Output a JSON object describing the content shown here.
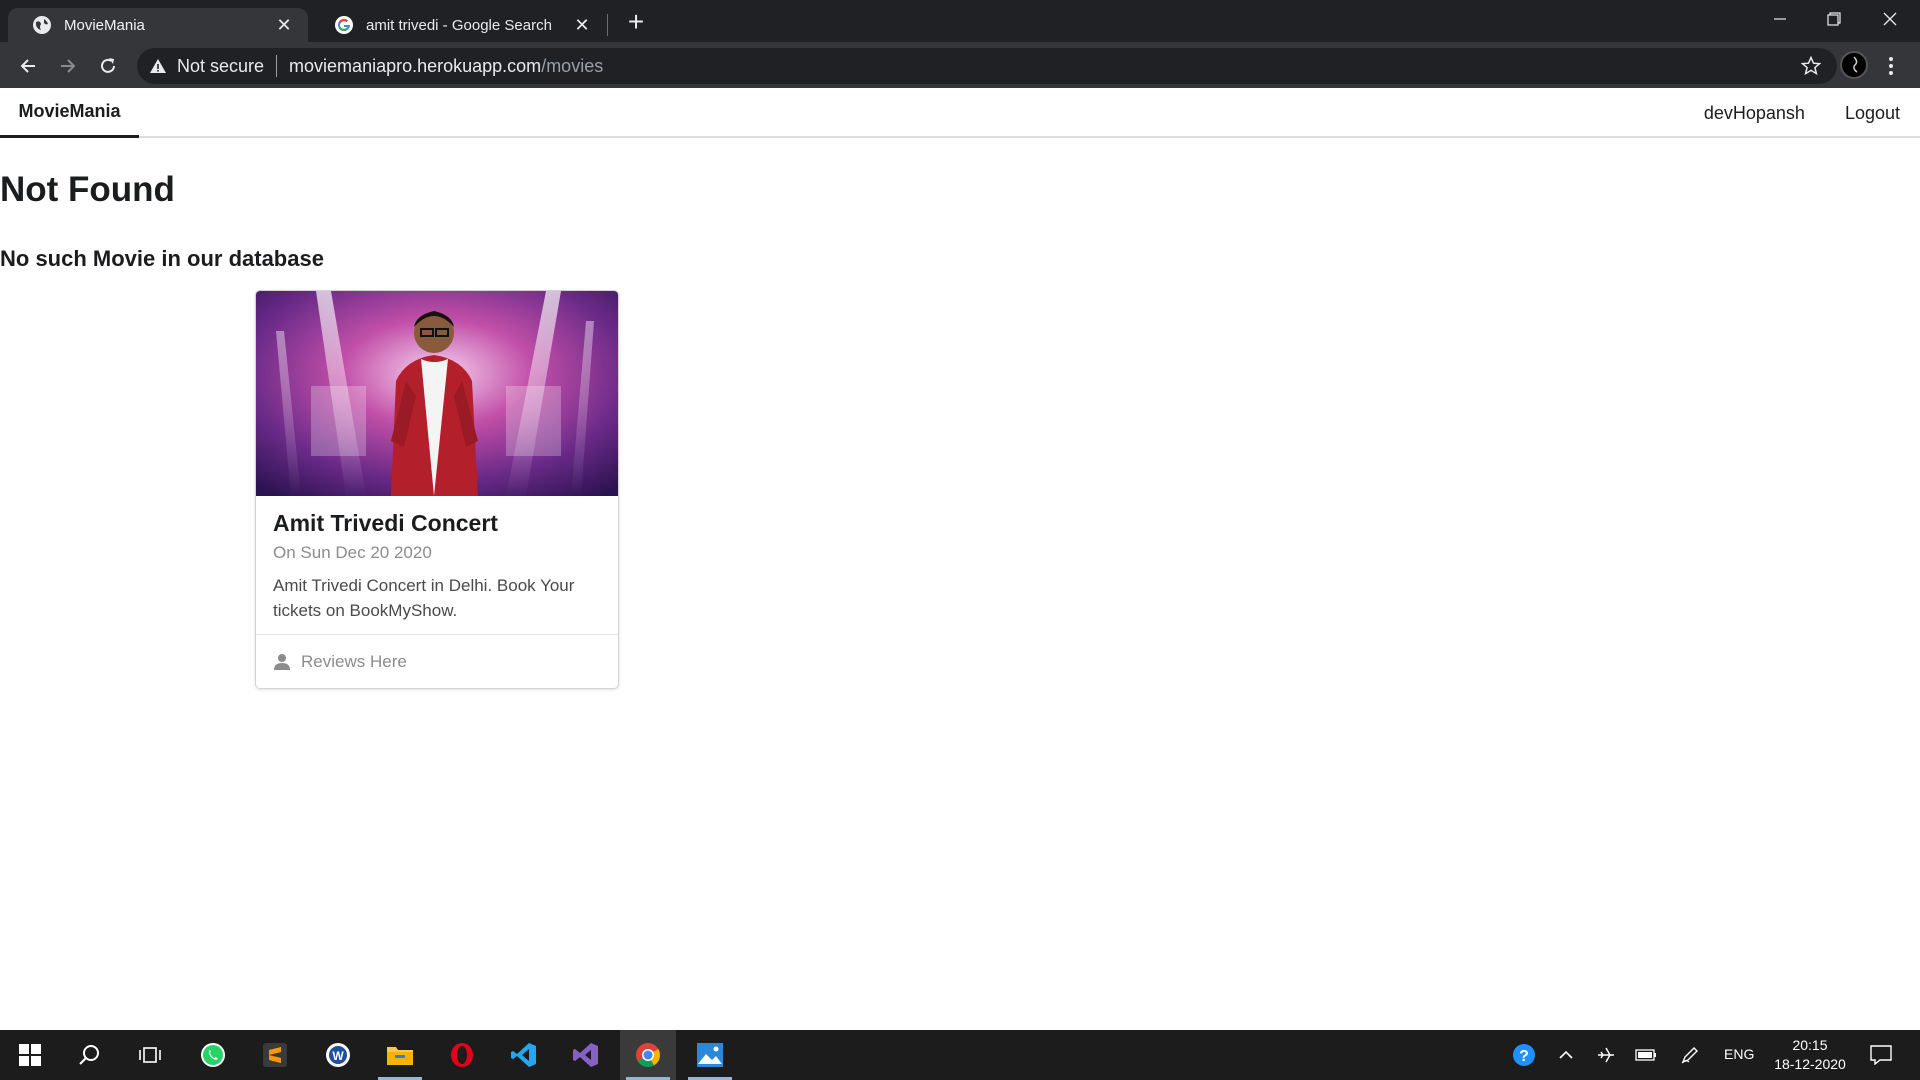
{
  "browser": {
    "tabs": [
      {
        "title": "MovieMania"
      },
      {
        "title": "amit trivedi - Google Search"
      }
    ],
    "omnibox": {
      "security_label": "Not secure",
      "url_host": "moviemaniapro.herokuapp.com",
      "url_path": "/movies"
    }
  },
  "navbar": {
    "brand": "MovieMania",
    "username": "devHopansh",
    "logout": "Logout"
  },
  "content": {
    "heading": "Not Found",
    "subheading": "No such Movie in our database"
  },
  "card": {
    "title": "Amit Trivedi Concert",
    "meta": "On Sun Dec 20 2020",
    "description": "Amit Trivedi Concert in Delhi. Book Your tickets on BookMyShow.",
    "extra": "Reviews Here"
  },
  "taskbar": {
    "language": "ENG",
    "time": "20:15",
    "date": "18-12-2020",
    "apps": [
      "start-icon",
      "search-icon",
      "task-view-icon",
      "whatsapp-icon",
      "sublime-text-icon",
      "word-app-icon",
      "file-explorer-icon",
      "opera-icon",
      "vscode-icon",
      "visual-studio-icon",
      "chrome-icon",
      "photos-icon"
    ]
  },
  "colors": {
    "chrome_dark": "#202124",
    "chrome_toolbar": "#35363a",
    "text_primary": "#1b1c1d",
    "text_muted": "#8c8c8c",
    "taskbar": "#1c1c1c"
  }
}
